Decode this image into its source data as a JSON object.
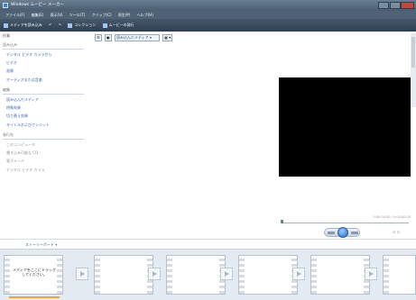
{
  "window": {
    "title": "Windows ムービー メーカー"
  },
  "menu": [
    "ファイル(F)",
    "編集(E)",
    "表示(V)",
    "ツール(T)",
    "クリップ(C)",
    "再生(P)",
    "ヘルプ(H)"
  ],
  "toolbar": {
    "media_label": "メディアを読み込み",
    "collection_label": "コレクション",
    "publish_label": "ムービーの発行"
  },
  "tasks": {
    "header": "作業",
    "sections": [
      {
        "title": "読み込み",
        "links": [
          "デジタル ビデオ カメラから",
          "ビデオ",
          "画像",
          "オーディオまたは音楽"
        ]
      },
      {
        "title": "編集",
        "links": [
          "読み込んだメディア",
          "特殊効果",
          "切り替え効果",
          "タイトルおよびクレジット"
        ]
      },
      {
        "title": "発行先",
        "links": [
          "このコンピュータ",
          "書き込み可能な CD",
          "電子メール",
          "デジタル ビデオ カメラ"
        ]
      }
    ]
  },
  "collection": {
    "dropdown": "読み込んだメディア"
  },
  "monitor": {
    "timecode": "0:00:00.00 / 0:00:00.00",
    "icon_names": [
      "seek-slider",
      "play-icon",
      "split-icon",
      "snapshot-icon"
    ]
  },
  "storyboard": {
    "header_label": "ストーリーボード",
    "first_clip_text": "メディアをここにドラッグしてください。",
    "clip_count": 6,
    "accent_color": "#f2a33d"
  },
  "colors": {
    "title_bar": "#4a5d70",
    "preview": "#000000",
    "storyboard_bg": "#e4eaf1",
    "link": "#3a67b0"
  }
}
